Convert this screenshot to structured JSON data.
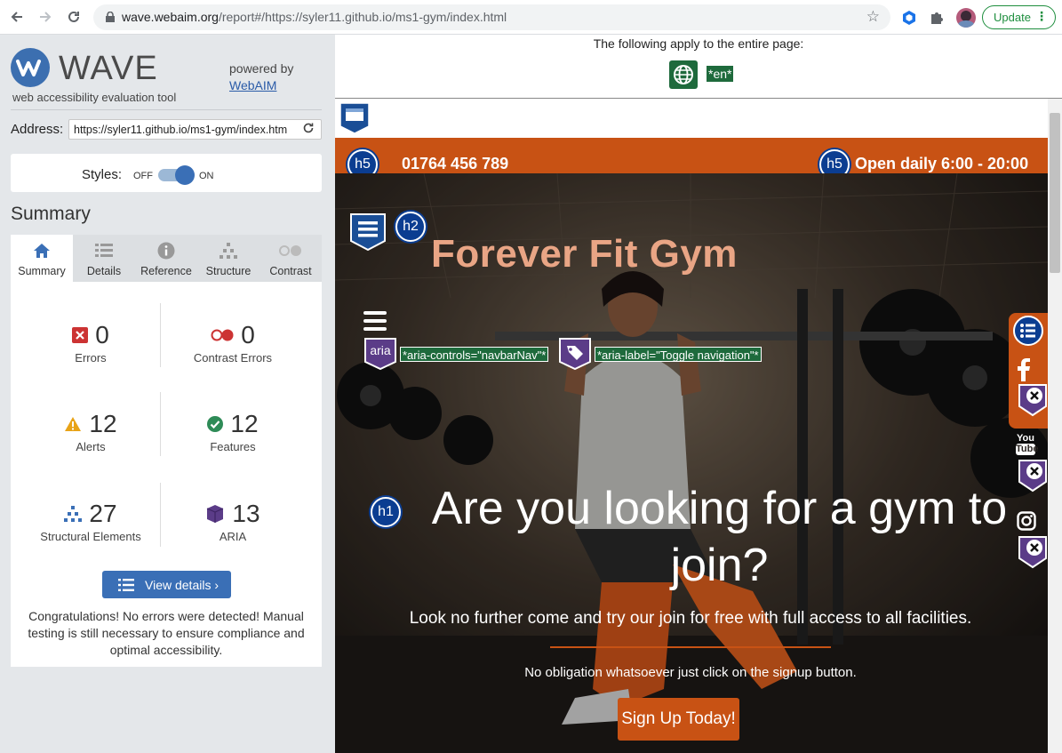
{
  "browser": {
    "url_host": "wave.webaim.org",
    "url_rest": "/report#/https://syler11.github.io/ms1-gym/index.html",
    "update_label": "Update"
  },
  "sidebar": {
    "logo_text": "WAVE",
    "logo_subtitle": "web accessibility evaluation tool",
    "powered_by": "powered by",
    "webaim_link": "WebAIM",
    "address_label": "Address:",
    "address_value": "https://syler11.github.io/ms1-gym/index.htm",
    "styles_label": "Styles:",
    "styles_off": "OFF",
    "styles_on": "ON",
    "summary_title": "Summary",
    "tabs": [
      {
        "label": "Summary",
        "icon": "home-icon"
      },
      {
        "label": "Details",
        "icon": "list-icon"
      },
      {
        "label": "Reference",
        "icon": "info-icon"
      },
      {
        "label": "Structure",
        "icon": "tree-icon"
      },
      {
        "label": "Contrast",
        "icon": "contrast-icon"
      }
    ],
    "stats": {
      "errors": {
        "value": "0",
        "label": "Errors",
        "color": "#c33"
      },
      "contrast_errors": {
        "value": "0",
        "label": "Contrast Errors",
        "color": "#c33"
      },
      "alerts": {
        "value": "12",
        "label": "Alerts",
        "color": "#e8a317"
      },
      "features": {
        "value": "12",
        "label": "Features",
        "color": "#2e8b57"
      },
      "structural": {
        "value": "27",
        "label": "Structural Elements",
        "color": "#3a6fb6"
      },
      "aria": {
        "value": "13",
        "label": "ARIA",
        "color": "#5b3c88"
      }
    },
    "view_details": "View details ›",
    "congrats": "Congratulations! No errors were detected! Manual testing is still necessary to ensure compliance and optimal accessibility."
  },
  "report": {
    "apply_text": "The following apply to the entire page:",
    "lang_tag": "*en*",
    "site": {
      "phone": "01764 456 789",
      "hours": "Open daily 6:00 - 20:00",
      "brand": "Forever Fit Gym",
      "aria_badge": "aria",
      "aria_controls": "*aria-controls=\"navbarNav\"*",
      "aria_label": "*aria-label=\"Toggle navigation\"*",
      "h5_badge": "h5",
      "h2_badge": "h2",
      "h1_badge": "h1",
      "hero_title": "Are you looking for a gym to join?",
      "hero_sub": "Look no further come and try our join for free with full access to all facilities.",
      "hero_note": "No obligation whatsoever just click on the signup button.",
      "signup": "Sign Up Today!",
      "social_youtube_line1": "You",
      "social_youtube_line2": "Tube"
    }
  },
  "colors": {
    "wave_blue": "#3a6fb6",
    "site_orange": "#c85214",
    "heading_badge": "#0b3d91",
    "aria_purple": "#5b3c88",
    "feature_green": "#1e6a3c"
  }
}
